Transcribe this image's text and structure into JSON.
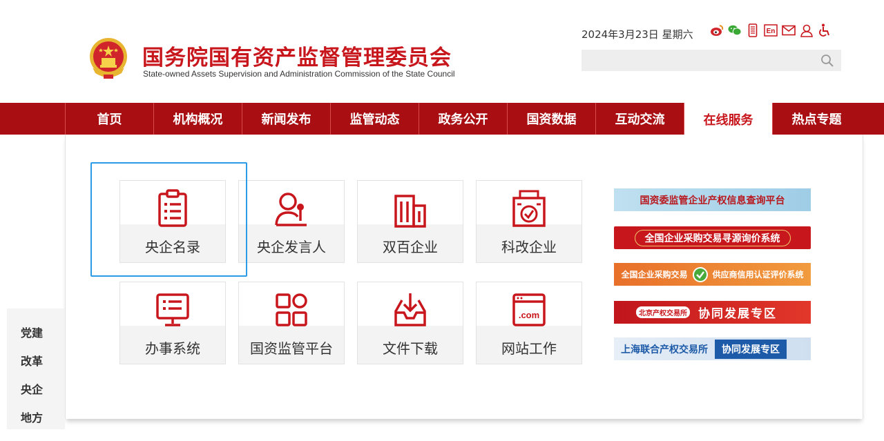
{
  "header": {
    "title": "国务院国有资产监督管理委员会",
    "subtitle": "State-owned Assets Supervision and Administration Commission of the State Council",
    "date": "2024年3月23日 星期六",
    "icons": [
      "weibo-icon",
      "wechat-icon",
      "mobile-icon",
      "english-icon",
      "mail-icon",
      "user-icon",
      "accessibility-icon"
    ],
    "english_label": "En",
    "search_placeholder": ""
  },
  "nav": {
    "items": [
      "首页",
      "机构概况",
      "新闻发布",
      "监管动态",
      "政务公开",
      "国资数据",
      "互动交流",
      "在线服务",
      "热点专题"
    ],
    "active_index": 7
  },
  "services": {
    "tiles": [
      {
        "label": "央企名录",
        "icon": "clipboard-icon"
      },
      {
        "label": "央企发言人",
        "icon": "spokesperson-icon"
      },
      {
        "label": "双百企业",
        "icon": "buildings-icon"
      },
      {
        "label": "科改企业",
        "icon": "certified-building-icon"
      },
      {
        "label": "办事系统",
        "icon": "monitor-icon"
      },
      {
        "label": "国资监管平台",
        "icon": "grid-icon"
      },
      {
        "label": "文件下载",
        "icon": "download-tray-icon"
      },
      {
        "label": "网站工作",
        "icon": "dotcom-icon"
      }
    ]
  },
  "banners": {
    "b1": "国资委监管企业产权信息查询平台",
    "b2": "全国企业采购交易寻源询价系统",
    "b3_left": "全国企业采购交易",
    "b3_right": "供应商信用认证评价系统",
    "b4_org": "北京产权交易所",
    "b4_main": "协同发展专区",
    "b5_org": "上海联合产权交易所",
    "b5_main": "协同发展专区"
  },
  "sidebar": {
    "items": [
      "党建",
      "改革",
      "央企",
      "地方"
    ]
  },
  "colors": {
    "brand_red": "#c8161d",
    "nav_red": "#a90f12",
    "highlight_blue": "#2b9be6"
  }
}
